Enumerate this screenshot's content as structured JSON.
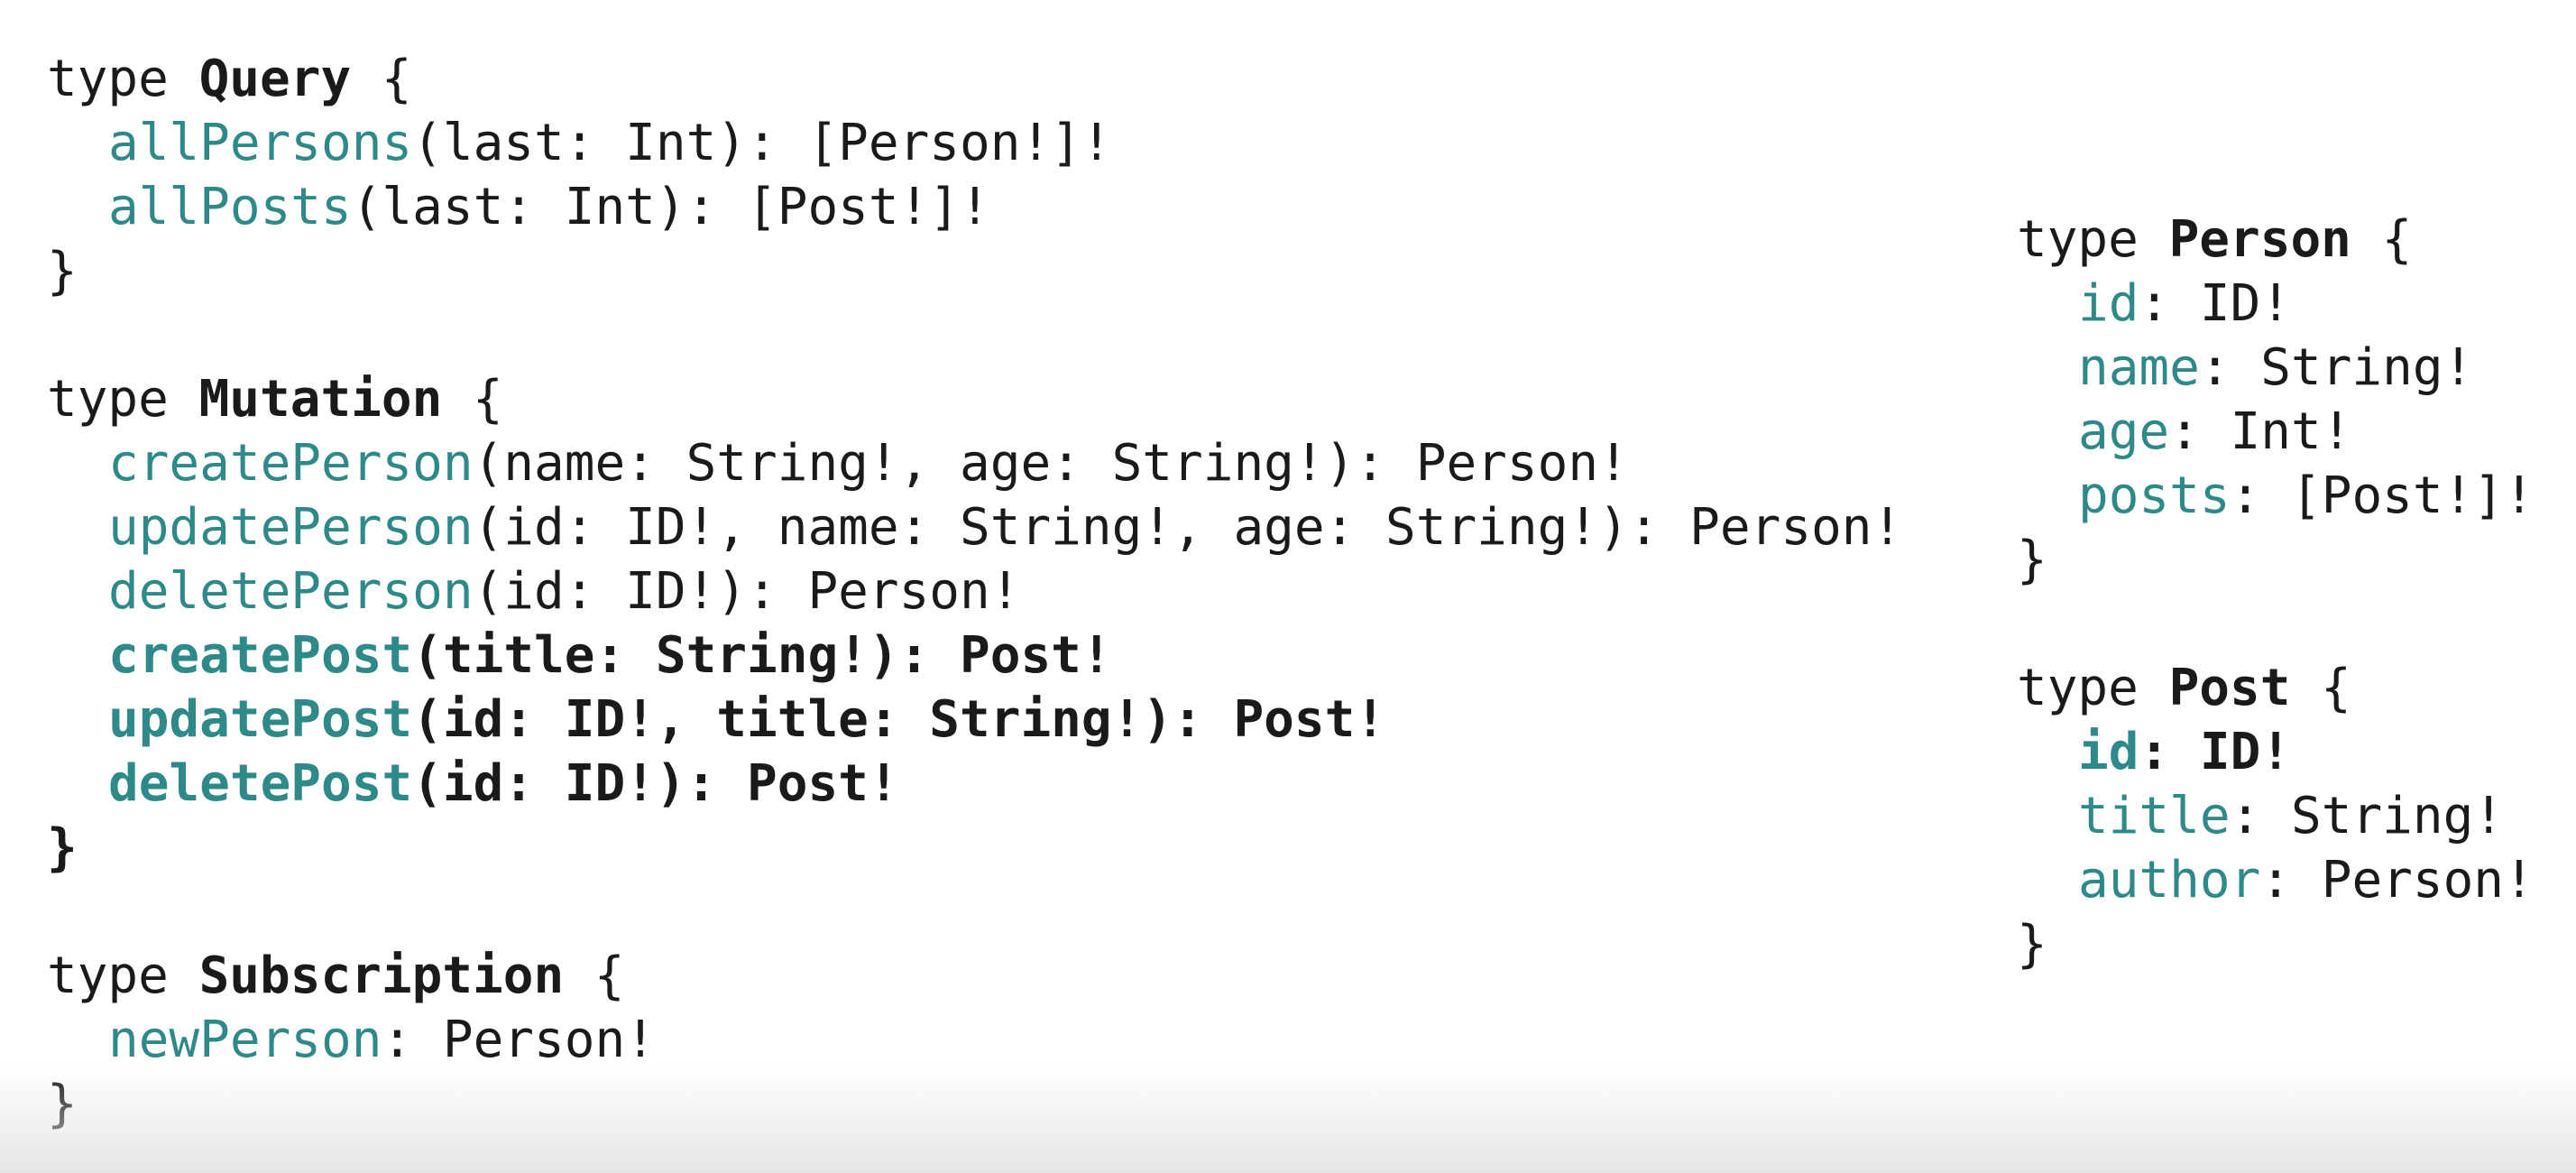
{
  "left": {
    "query": {
      "keyword": "type",
      "name": "Query",
      "open": "{",
      "close": "}",
      "fields": [
        {
          "name": "allPersons",
          "rest": "(last: Int): [Person!]!"
        },
        {
          "name": "allPosts",
          "rest": "(last: Int): [Post!]!"
        }
      ]
    },
    "mutation": {
      "keyword": "type",
      "name": "Mutation",
      "open": "{",
      "close": "}",
      "fields": [
        {
          "name": "createPerson",
          "rest": "(name: String!, age: String!): Person!"
        },
        {
          "name": "updatePerson",
          "rest": "(id: ID!, name: String!, age: String!): Person!"
        },
        {
          "name": "deletePerson",
          "rest": "(id: ID!): Person!"
        },
        {
          "name": "createPost",
          "rest": "(title: String!): Post!"
        },
        {
          "name": "updatePost",
          "rest": "(id: ID!, title: String!): Post!"
        },
        {
          "name": "deletePost",
          "rest": "(id: ID!): Post!"
        }
      ]
    },
    "subscription": {
      "keyword": "type",
      "name": "Subscription",
      "open": "{",
      "close": "}",
      "fields": [
        {
          "name": "newPerson",
          "rest": ": Person!"
        }
      ]
    }
  },
  "right": {
    "person": {
      "keyword": "type",
      "name": "Person",
      "open": "{",
      "close": "}",
      "fields": [
        {
          "name": "id",
          "rest": ": ID!"
        },
        {
          "name": "name",
          "rest": ": String!"
        },
        {
          "name": "age",
          "rest": ": Int!"
        },
        {
          "name": "posts",
          "rest": ": [Post!]!"
        }
      ]
    },
    "post": {
      "keyword": "type",
      "name": "Post",
      "open": "{",
      "close": "}",
      "fields": [
        {
          "name": "id",
          "rest": ": ID!"
        },
        {
          "name": "title",
          "rest": ": String!"
        },
        {
          "name": "author",
          "rest": ": Person!"
        }
      ]
    }
  },
  "colors": {
    "field": "#2e8a88",
    "text": "#1a1a1a",
    "background": "#ffffff"
  }
}
